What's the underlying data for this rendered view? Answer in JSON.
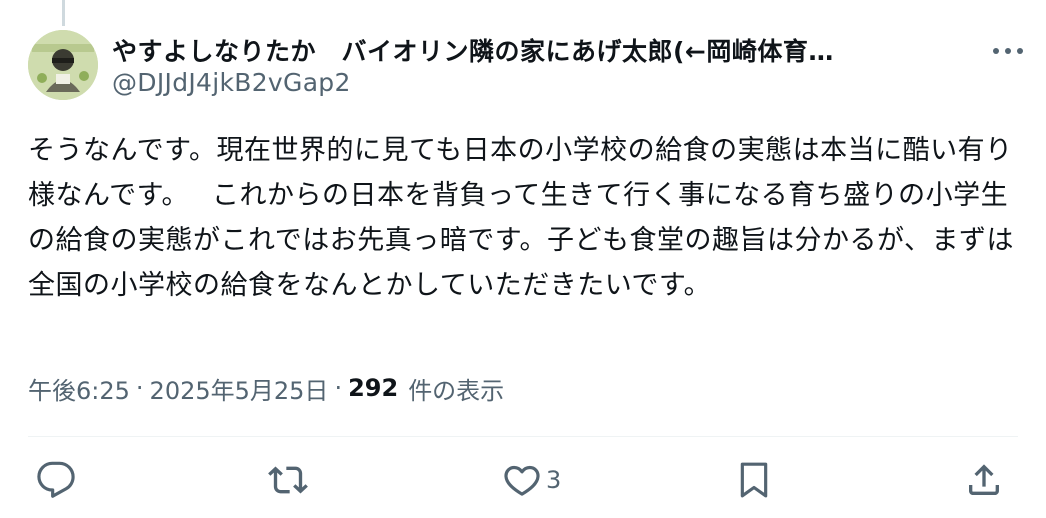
{
  "author": {
    "display_name": "やすよしなりたか　バイオリン隣の家にあげ太郎(←岡崎体育…",
    "handle": "@DJJdJ4jkB2vGap2"
  },
  "tweet": {
    "text": "そうなんです。現在世界的に見ても日本の小学校の給食の実態は本当に酷い有り様なんです。　 これからの日本を背負って生きて行く事になる育ち盛りの小学生の給食の実態がこれではお先真っ暗です。子ども食堂の趣旨は分かるが、まずは全国の小学校の給食をなんとかしていただきたいです。"
  },
  "meta": {
    "time": "午後6:25",
    "separator": "·",
    "date": "2025年5月25日",
    "views_count": "292",
    "views_label": "件の表示"
  },
  "actions": {
    "reply_count": "",
    "retweet_count": "",
    "like_count": "3",
    "bookmark_count": ""
  },
  "icons": {
    "more": "more-horizontal-icon",
    "reply": "reply-icon",
    "retweet": "retweet-icon",
    "like": "heart-icon",
    "bookmark": "bookmark-icon",
    "share": "share-icon"
  },
  "colors": {
    "text": "#0f1419",
    "secondary": "#536471",
    "divider": "#eff3f4",
    "thread_line": "#cfd9de"
  }
}
